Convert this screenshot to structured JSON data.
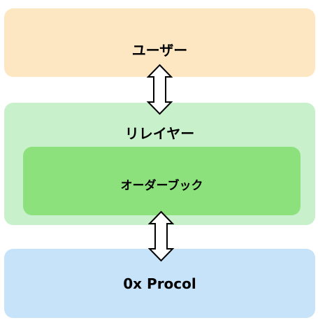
{
  "boxes": {
    "user": {
      "label": "ユーザー",
      "color": "#FDE7C3"
    },
    "relayer": {
      "label": "リレイヤー",
      "color": "#C8F0CA"
    },
    "orderbook": {
      "label": "オーダーブック",
      "color": "#8CE17C"
    },
    "protocol": {
      "label": "0x Procol",
      "color": "#C6E3F9"
    }
  },
  "connectors": [
    {
      "from": "user",
      "to": "relayer",
      "type": "bidirectional-arrow"
    },
    {
      "from": "relayer",
      "to": "protocol",
      "type": "bidirectional-arrow"
    }
  ]
}
